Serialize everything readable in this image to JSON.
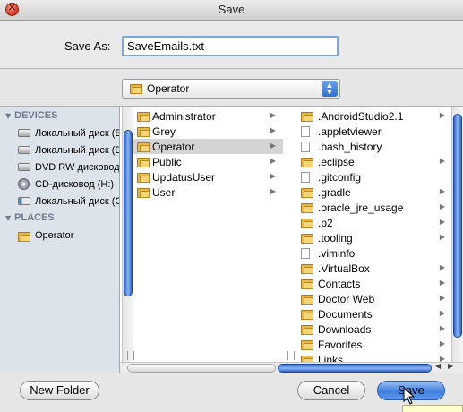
{
  "window": {
    "title": "Save"
  },
  "save_as": {
    "label": "Save As:",
    "value": "SaveEmails.txt"
  },
  "location": {
    "selected": "Operator"
  },
  "sidebar": {
    "devices_header": "DEVICES",
    "places_header": "PLACES",
    "devices": [
      {
        "label": "Локальный диск (E",
        "icon": "hard-drive-icon"
      },
      {
        "label": "Локальный диск (D",
        "icon": "hard-drive-icon"
      },
      {
        "label": "DVD RW дисковод",
        "icon": "dvd-drive-icon"
      },
      {
        "label": "CD-дисковод (H:)",
        "icon": "cd-icon"
      },
      {
        "label": "Локальный диск (C",
        "icon": "system-drive-icon"
      }
    ],
    "places": [
      {
        "label": "Operator",
        "icon": "home-folder-icon"
      }
    ]
  },
  "column1": {
    "items": [
      {
        "label": "Administrator",
        "type": "folder"
      },
      {
        "label": "Grey",
        "type": "folder"
      },
      {
        "label": "Operator",
        "type": "folder",
        "selected": true
      },
      {
        "label": "Public",
        "type": "folder"
      },
      {
        "label": "UpdatusUser",
        "type": "folder"
      },
      {
        "label": "User",
        "type": "folder"
      }
    ]
  },
  "column2": {
    "items": [
      {
        "label": ".AndroidStudio2.1",
        "type": "folder"
      },
      {
        "label": ".appletviewer",
        "type": "file"
      },
      {
        "label": ".bash_history",
        "type": "file"
      },
      {
        "label": ".eclipse",
        "type": "folder"
      },
      {
        "label": ".gitconfig",
        "type": "file"
      },
      {
        "label": ".gradle",
        "type": "folder"
      },
      {
        "label": ".oracle_jre_usage",
        "type": "folder"
      },
      {
        "label": ".p2",
        "type": "folder"
      },
      {
        "label": ".tooling",
        "type": "folder"
      },
      {
        "label": ".viminfo",
        "type": "file"
      },
      {
        "label": ".VirtualBox",
        "type": "folder"
      },
      {
        "label": "Contacts",
        "type": "folder"
      },
      {
        "label": "Doctor Web",
        "type": "folder"
      },
      {
        "label": "Documents",
        "type": "folder"
      },
      {
        "label": "Downloads",
        "type": "folder"
      },
      {
        "label": "Favorites",
        "type": "folder"
      },
      {
        "label": "Links",
        "type": "folder"
      }
    ]
  },
  "buttons": {
    "new_folder": "New Folder",
    "cancel": "Cancel",
    "save": "Save"
  },
  "colors": {
    "accent": "#3f7fe0",
    "sidebar_bg": "#dde3ea",
    "selection": "#d4d4d4"
  }
}
